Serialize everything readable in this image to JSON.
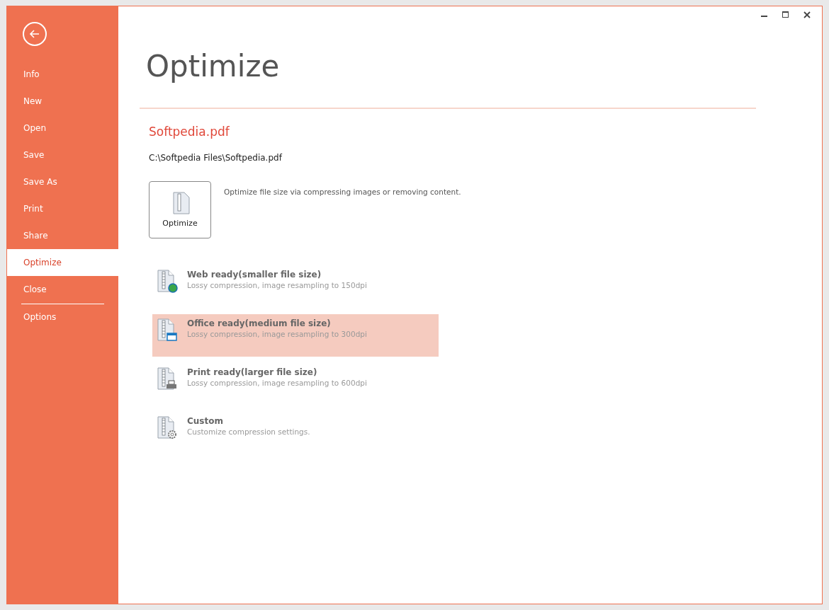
{
  "window": {
    "controls": [
      {
        "kind": "minimize"
      },
      {
        "kind": "maximize"
      },
      {
        "kind": "close"
      }
    ]
  },
  "sidebar": {
    "items": [
      {
        "label": "Info",
        "selected": false,
        "divider_above": false
      },
      {
        "label": "New",
        "selected": false,
        "divider_above": false
      },
      {
        "label": "Open",
        "selected": false,
        "divider_above": false
      },
      {
        "label": "Save",
        "selected": false,
        "divider_above": false
      },
      {
        "label": "Save As",
        "selected": false,
        "divider_above": false
      },
      {
        "label": "Print",
        "selected": false,
        "divider_above": false
      },
      {
        "label": "Share",
        "selected": false,
        "divider_above": false
      },
      {
        "label": "Optimize",
        "selected": true,
        "divider_above": false
      },
      {
        "label": "Close",
        "selected": false,
        "divider_above": false
      },
      {
        "label": "Options",
        "selected": false,
        "divider_above": true
      }
    ]
  },
  "page": {
    "title": "Optimize",
    "file_name": "Softpedia.pdf",
    "file_path": "C:\\Softpedia Files\\Softpedia.pdf",
    "optimize_button": {
      "label": "Optimize"
    },
    "description": "Optimize file size via compressing images or removing content.",
    "options": [
      {
        "kind": "web",
        "title": "Web ready(smaller file size)",
        "subtitle": "Lossy compression, image resampling to 150dpi",
        "selected": false
      },
      {
        "kind": "office",
        "title": "Office ready(medium file size)",
        "subtitle": "Lossy compression, image resampling to 300dpi",
        "selected": true
      },
      {
        "kind": "print",
        "title": "Print ready(larger file size)",
        "subtitle": "Lossy compression, image resampling to 600dpi",
        "selected": false
      },
      {
        "kind": "custom",
        "title": "Custom",
        "subtitle": "Customize compression settings.",
        "selected": false
      }
    ]
  }
}
